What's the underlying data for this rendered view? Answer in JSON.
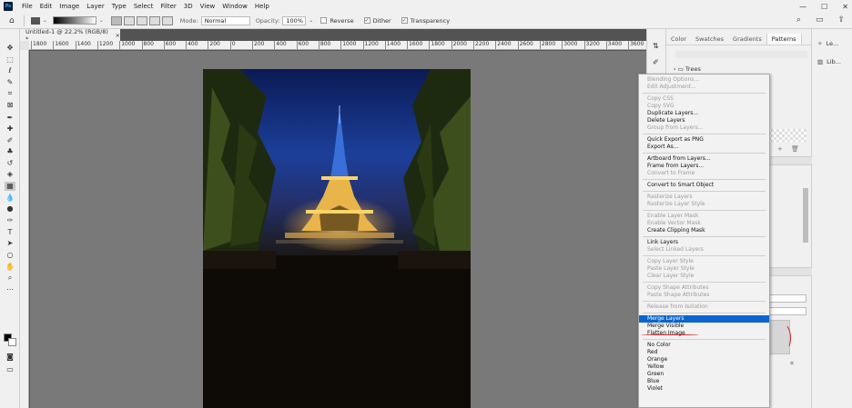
{
  "app": {
    "logo_text": "Ps",
    "brand_color": "#31a8ff"
  },
  "menubar": {
    "items": [
      "File",
      "Edit",
      "Image",
      "Layer",
      "Type",
      "Select",
      "Filter",
      "3D",
      "View",
      "Window",
      "Help"
    ]
  },
  "window_controls": {
    "minimize": "—",
    "maximize": "☐",
    "close": "✕"
  },
  "options": {
    "mode_label": "Mode:",
    "mode_value": "Normal",
    "opacity_label": "Opacity:",
    "opacity_value": "100%",
    "reverse_label": "Reverse",
    "dither_label": "Dither",
    "transparency_label": "Transparency",
    "reverse_checked": false,
    "dither_checked": true,
    "transparency_checked": true
  },
  "document": {
    "tab_title": "Untitled-1 @ 22.2% (RGB/8) *",
    "close_glyph": "×"
  },
  "ruler": {
    "labels": [
      "1800",
      "1600",
      "1400",
      "1200",
      "1000",
      "800",
      "600",
      "400",
      "200",
      "0",
      "200",
      "400",
      "600",
      "800",
      "1000",
      "1200",
      "1400",
      "1600",
      "1800",
      "2000",
      "2200",
      "2400",
      "2600",
      "2800",
      "3000",
      "3200",
      "3400",
      "3600"
    ]
  },
  "panel": {
    "tabs": [
      "Color",
      "Swatches",
      "Gradients",
      "Patterns"
    ],
    "active_tab": "Patterns",
    "trees_label": "Trees",
    "side_entries": [
      "Le...",
      "Lib..."
    ]
  },
  "context_menu": {
    "items": [
      {
        "label": "Blending Options...",
        "state": "disabled"
      },
      {
        "label": "Edit Adjustment...",
        "state": "disabled"
      },
      {
        "sep": true
      },
      {
        "label": "Copy CSS",
        "state": "disabled"
      },
      {
        "label": "Copy SVG",
        "state": "disabled"
      },
      {
        "label": "Duplicate Layers...",
        "state": "enabled"
      },
      {
        "label": "Delete Layers",
        "state": "enabled"
      },
      {
        "label": "Group from Layers...",
        "state": "disabled"
      },
      {
        "sep": true
      },
      {
        "label": "Quick Export as PNG",
        "state": "enabled"
      },
      {
        "label": "Export As...",
        "state": "enabled"
      },
      {
        "sep": true
      },
      {
        "label": "Artboard from Layers...",
        "state": "enabled"
      },
      {
        "label": "Frame from Layers...",
        "state": "enabled"
      },
      {
        "label": "Convert to Frame",
        "state": "disabled"
      },
      {
        "sep": true
      },
      {
        "label": "Convert to Smart Object",
        "state": "enabled"
      },
      {
        "sep": true
      },
      {
        "label": "Rasterize Layers",
        "state": "disabled"
      },
      {
        "label": "Rasterize Layer Style",
        "state": "disabled"
      },
      {
        "sep": true
      },
      {
        "label": "Enable Layer Mask",
        "state": "disabled"
      },
      {
        "label": "Enable Vector Mask",
        "state": "disabled"
      },
      {
        "label": "Create Clipping Mask",
        "state": "enabled"
      },
      {
        "sep": true
      },
      {
        "label": "Link Layers",
        "state": "enabled"
      },
      {
        "label": "Select Linked Layers",
        "state": "disabled"
      },
      {
        "sep": true
      },
      {
        "label": "Copy Layer Style",
        "state": "disabled"
      },
      {
        "label": "Paste Layer Style",
        "state": "disabled"
      },
      {
        "label": "Clear Layer Style",
        "state": "disabled"
      },
      {
        "sep": true
      },
      {
        "label": "Copy Shape Attributes",
        "state": "disabled"
      },
      {
        "label": "Paste Shape Attributes",
        "state": "disabled"
      },
      {
        "sep": true
      },
      {
        "label": "Release from Isolation",
        "state": "disabled"
      },
      {
        "sep": true
      },
      {
        "label": "Merge Layers",
        "state": "highlighted"
      },
      {
        "label": "Merge Visible",
        "state": "enabled"
      },
      {
        "label": "Flatten Image",
        "state": "enabled"
      },
      {
        "sep": true
      },
      {
        "label": "No Color",
        "state": "enabled"
      },
      {
        "label": "Red",
        "state": "enabled"
      },
      {
        "label": "Orange",
        "state": "enabled"
      },
      {
        "label": "Yellow",
        "state": "enabled"
      },
      {
        "label": "Green",
        "state": "enabled"
      },
      {
        "label": "Blue",
        "state": "enabled"
      },
      {
        "label": "Violet",
        "state": "enabled"
      }
    ]
  },
  "colors": {
    "highlight": "#0a64d3",
    "annotation_red": "#d12c2c",
    "canvas_bg": "#797979"
  }
}
